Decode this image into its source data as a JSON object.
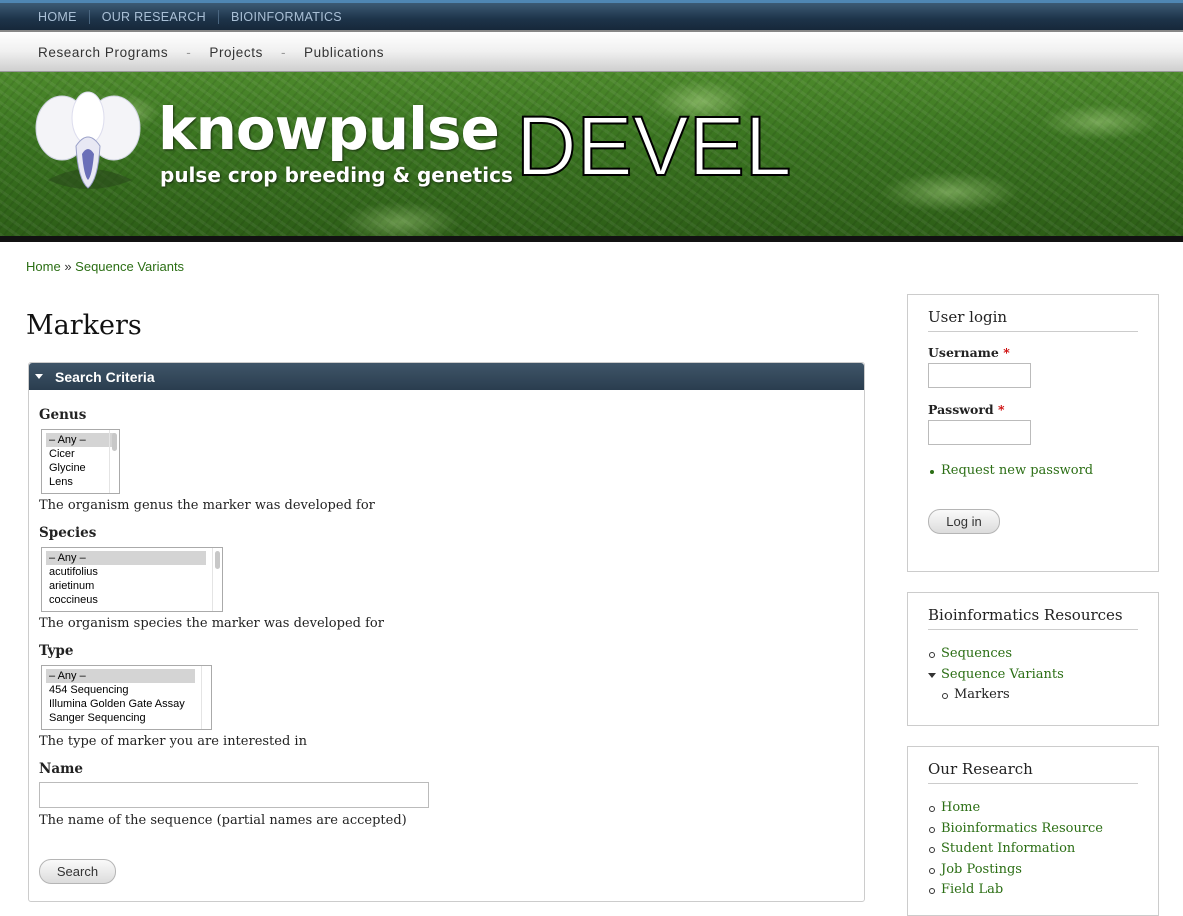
{
  "top_nav": [
    "HOME",
    "OUR RESEARCH",
    "BIOINFORMATICS"
  ],
  "sub_nav": {
    "items": [
      "Research Programs",
      "Projects",
      "Publications"
    ],
    "separator": "-"
  },
  "banner": {
    "site_name": "knowpulse",
    "slogan": "pulse crop breeding & genetics",
    "env_label": "DEVEL"
  },
  "breadcrumb": {
    "home": "Home",
    "sep": "»",
    "current": "Sequence Variants"
  },
  "page_title": "Markers",
  "search": {
    "legend": "Search Criteria",
    "genus": {
      "label": "Genus",
      "options": [
        "– Any –",
        "Cicer",
        "Glycine",
        "Lens"
      ],
      "selected": "– Any –",
      "description": "The organism genus the marker was developed for"
    },
    "species": {
      "label": "Species",
      "options": [
        "– Any –",
        "acutifolius",
        "arietinum",
        "coccineus"
      ],
      "selected": "– Any –",
      "description": "The organism species the marker was developed for"
    },
    "type": {
      "label": "Type",
      "options": [
        "– Any –",
        "454 Sequencing",
        "Illumina Golden Gate Assay",
        "Sanger Sequencing"
      ],
      "selected": "– Any –",
      "description": "The type of marker you are interested in"
    },
    "name": {
      "label": "Name",
      "value": "",
      "description": "The name of the sequence (partial names are accepted)"
    },
    "submit_label": "Search"
  },
  "user_login": {
    "title": "User login",
    "username_label": "Username",
    "password_label": "Password",
    "required_mark": "*",
    "username_value": "",
    "password_value": "",
    "request_password": "Request new password",
    "login_button": "Log in"
  },
  "bioinformatics": {
    "title": "Bioinformatics Resources",
    "items": [
      "Sequences",
      "Sequence Variants",
      "Markers"
    ]
  },
  "our_research": {
    "title": "Our Research",
    "items": [
      "Home",
      "Bioinformatics Resource",
      "Student Information",
      "Job Postings",
      "Field Lab"
    ]
  },
  "colors": {
    "link": "#2b6e14",
    "top_nav_bg": "#1d3349",
    "legend_bg": "#2a3d4f",
    "required": "#cc0000"
  }
}
